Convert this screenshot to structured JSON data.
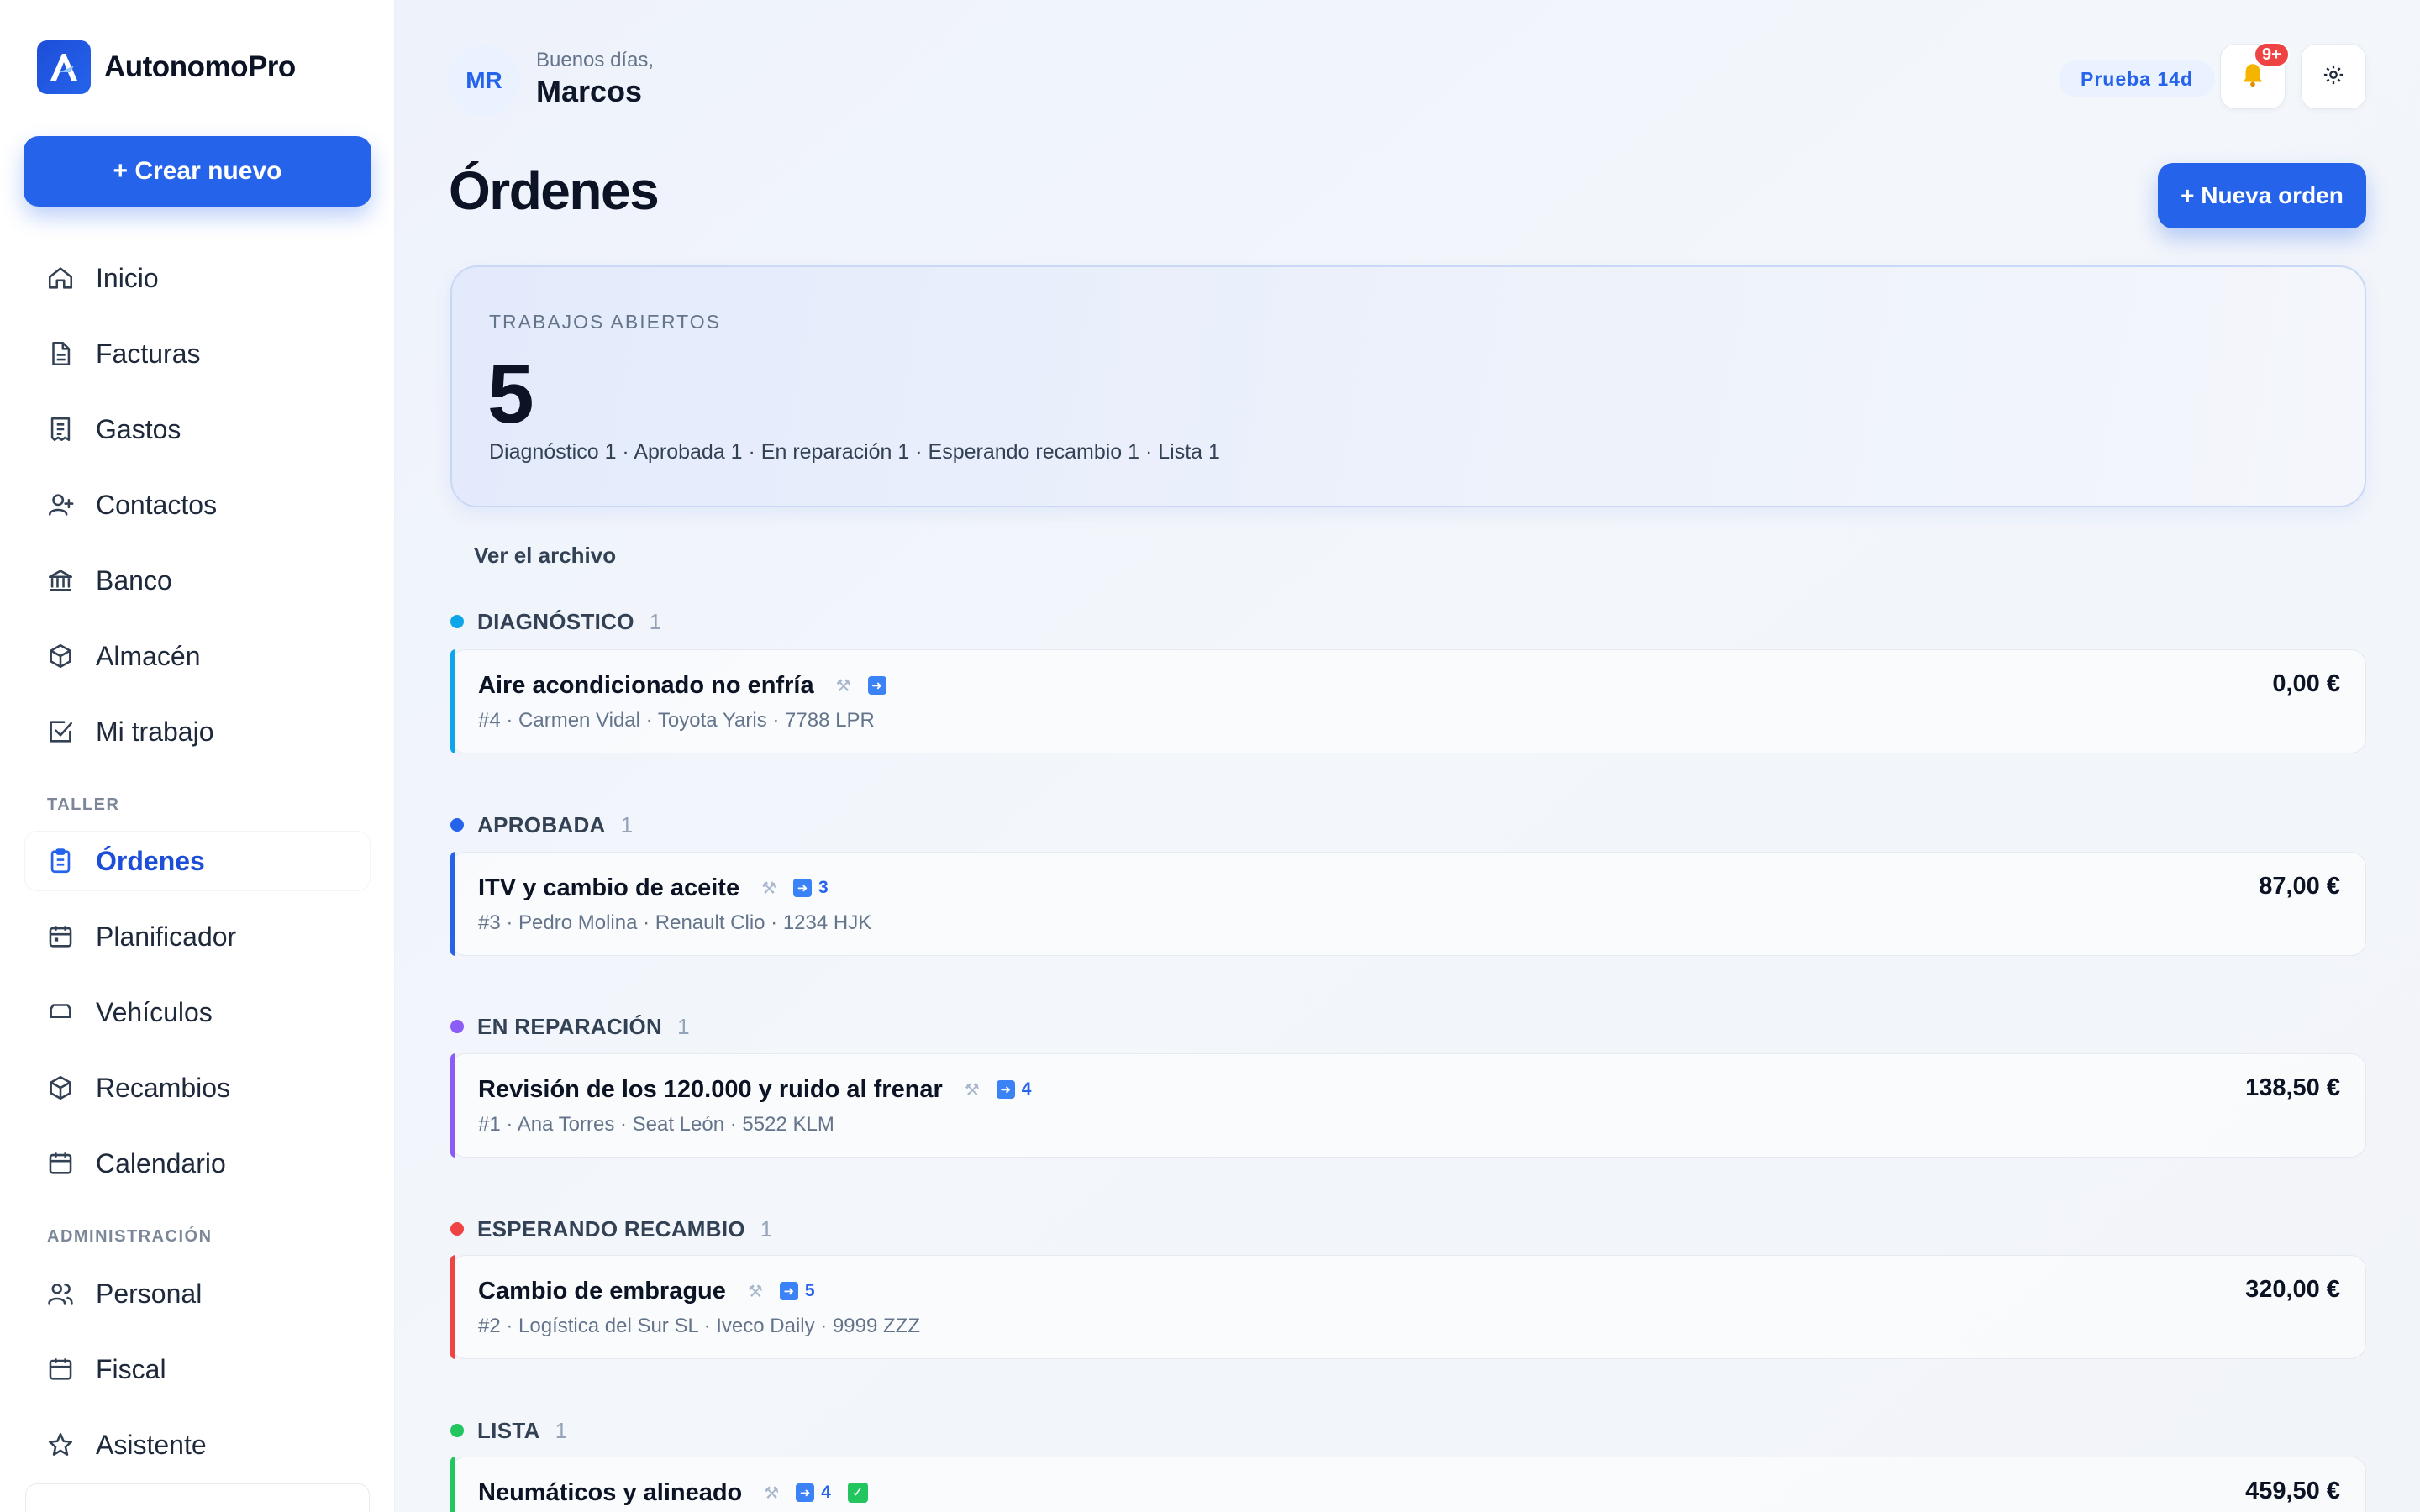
{
  "brand": {
    "name": "AutonomoPro"
  },
  "sidebar": {
    "create_label": "+ Crear nuevo",
    "main_items": [
      {
        "label": "Inicio",
        "icon": "home-icon"
      },
      {
        "label": "Facturas",
        "icon": "document-icon"
      },
      {
        "label": "Gastos",
        "icon": "receipt-icon"
      },
      {
        "label": "Contactos",
        "icon": "user-plus-icon"
      },
      {
        "label": "Banco",
        "icon": "bank-icon"
      },
      {
        "label": "Almacén",
        "icon": "box-icon"
      },
      {
        "label": "Mi trabajo",
        "icon": "checkbox-icon"
      }
    ],
    "taller_label": "TALLER",
    "taller_items": [
      {
        "label": "Órdenes",
        "icon": "clipboard-icon",
        "active": true
      },
      {
        "label": "Planificador",
        "icon": "calendar-icon"
      },
      {
        "label": "Vehículos",
        "icon": "car-icon"
      },
      {
        "label": "Recambios",
        "icon": "box-icon"
      },
      {
        "label": "Calendario",
        "icon": "calendar-icon"
      }
    ],
    "admin_label": "ADMINISTRACIÓN",
    "admin_items": [
      {
        "label": "Personal",
        "icon": "users-icon"
      },
      {
        "label": "Fiscal",
        "icon": "calendar-icon"
      },
      {
        "label": "Asistente",
        "icon": "star-icon"
      }
    ]
  },
  "header": {
    "avatar_initials": "MR",
    "greeting": "Buenos días,",
    "user_name": "Marcos",
    "trial_badge": "Prueba 14d",
    "notification_count": "9+"
  },
  "page": {
    "title": "Órdenes",
    "new_order_label": "+ Nueva orden"
  },
  "summary": {
    "label": "TRABAJOS ABIERTOS",
    "count": "5",
    "breakdown": "Diagnóstico 1 · Aprobada 1 · En reparación 1 · Esperando recambio 1 · Lista 1"
  },
  "archive_link": "Ver el archivo",
  "groups": [
    {
      "label": "DIAGNÓSTICO",
      "count": "1",
      "color": "#0ea5e9",
      "order": {
        "title": "Aire acondicionado no enfría",
        "chip": "",
        "checked": false,
        "meta": "#4 · Carmen Vidal · Toyota Yaris · 7788 LPR",
        "price": "0,00 €"
      }
    },
    {
      "label": "APROBADA",
      "count": "1",
      "color": "#2563eb",
      "order": {
        "title": "ITV y cambio de aceite",
        "chip": "3",
        "checked": false,
        "meta": "#3 · Pedro Molina · Renault Clio · 1234 HJK",
        "price": "87,00 €"
      }
    },
    {
      "label": "EN REPARACIÓN",
      "count": "1",
      "color": "#8b5cf6",
      "order": {
        "title": "Revisión de los 120.000 y ruido al frenar",
        "chip": "4",
        "checked": false,
        "meta": "#1 · Ana Torres · Seat León · 5522 KLM",
        "price": "138,50 €"
      }
    },
    {
      "label": "ESPERANDO RECAMBIO",
      "count": "1",
      "color": "#ef4444",
      "order": {
        "title": "Cambio de embrague",
        "chip": "5",
        "checked": false,
        "meta": "#2 · Logística del Sur SL · Iveco Daily · 9999 ZZZ",
        "price": "320,00 €"
      }
    },
    {
      "label": "LISTA",
      "count": "1",
      "color": "#22c55e",
      "order": {
        "title": "Neumáticos y alineado",
        "chip": "4",
        "checked": true,
        "meta": "",
        "price": "459,50 €"
      }
    }
  ]
}
